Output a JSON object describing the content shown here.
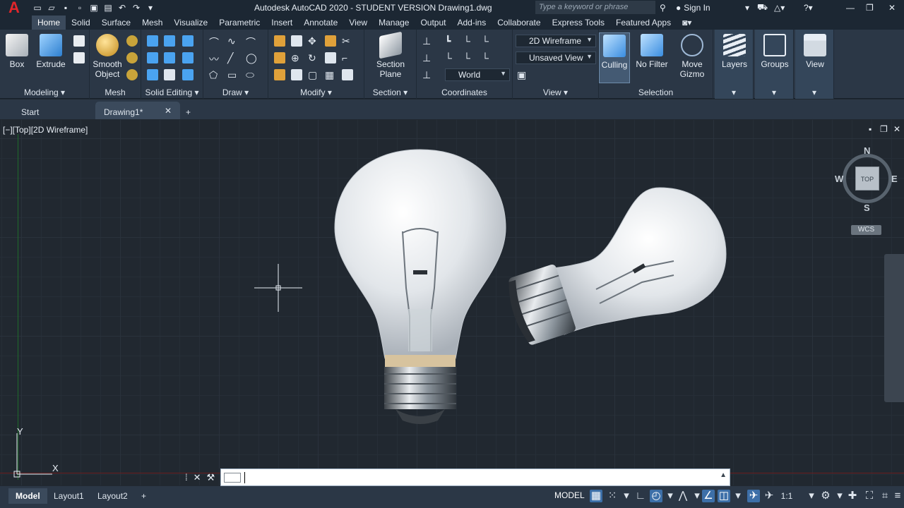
{
  "title": {
    "app_logo": "A",
    "text": "Autodesk AutoCAD 2020 - STUDENT VERSION    Drawing1.dwg",
    "search_placeholder": "Type a keyword or phrase",
    "sign_in": "Sign In"
  },
  "ribbon_tabs": [
    "Home",
    "Solid",
    "Surface",
    "Mesh",
    "Visualize",
    "Parametric",
    "Insert",
    "Annotate",
    "View",
    "Manage",
    "Output",
    "Add-ins",
    "Collaborate",
    "Express Tools",
    "Featured Apps"
  ],
  "ribbon": {
    "box": "Box",
    "extrude": "Extrude",
    "smooth_object": "Smooth\nObject",
    "section_plane": "Section\nPlane",
    "visual_style": "2D Wireframe",
    "view_combo": "Unsaved View",
    "ucs_combo": "World",
    "culling": "Culling",
    "no_filter": "No Filter",
    "move_gizmo": "Move\nGizmo",
    "layers": "Layers",
    "groups": "Groups",
    "view": "View",
    "panels": {
      "modeling": "Modeling ▾",
      "mesh": "Mesh",
      "solid_editing": "Solid Editing ▾",
      "draw": "Draw ▾",
      "modify": "Modify ▾",
      "section": "Section ▾",
      "coordinates": "Coordinates",
      "view": "View ▾",
      "selection": "Selection"
    }
  },
  "file_tabs": {
    "start": "Start",
    "drawing": "Drawing1*"
  },
  "viewport": {
    "label": "[−][Top][2D Wireframe]",
    "compass_n": "N",
    "compass_s": "S",
    "compass_e": "E",
    "compass_w": "W",
    "cube_face": "TOP",
    "wcs": "WCS",
    "ucs_y": "Y",
    "ucs_x": "X"
  },
  "layout_tabs": [
    "Model",
    "Layout1",
    "Layout2"
  ],
  "status": {
    "model": "MODEL",
    "scale": "1:1"
  },
  "colors": {
    "accent": "#3d6fa8",
    "logo_red": "#e0262b",
    "canvas": "#212830"
  }
}
